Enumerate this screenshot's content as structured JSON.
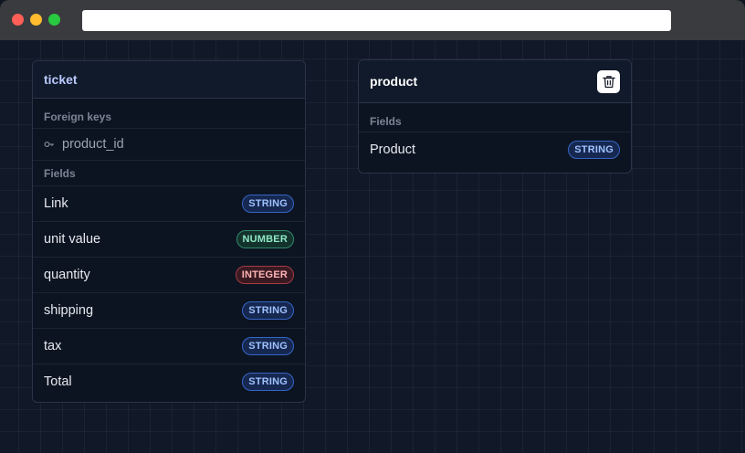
{
  "window": {
    "url": ""
  },
  "colors": {
    "canvas_bg": "#111827",
    "ticket_title": "#b9c9ff",
    "product_title": "#ffffff",
    "string_badge": "#3565c7",
    "number_badge": "#2f8a6c",
    "integer_badge": "#a53a44"
  },
  "ticket": {
    "title": "ticket",
    "foreign_keys_label": "Foreign keys",
    "foreign_keys": [
      {
        "name": "product_id",
        "icon": "key-icon"
      }
    ],
    "fields_label": "Fields",
    "fields": [
      {
        "name": "Link",
        "type": "STRING"
      },
      {
        "name": "unit value",
        "type": "NUMBER"
      },
      {
        "name": "quantity",
        "type": "INTEGER"
      },
      {
        "name": "shipping",
        "type": "STRING"
      },
      {
        "name": "tax",
        "type": "STRING"
      },
      {
        "name": "Total",
        "type": "STRING"
      }
    ]
  },
  "product": {
    "title": "product",
    "delete_icon": "trash-icon",
    "fields_label": "Fields",
    "fields": [
      {
        "name": "Product",
        "type": "STRING"
      }
    ]
  }
}
